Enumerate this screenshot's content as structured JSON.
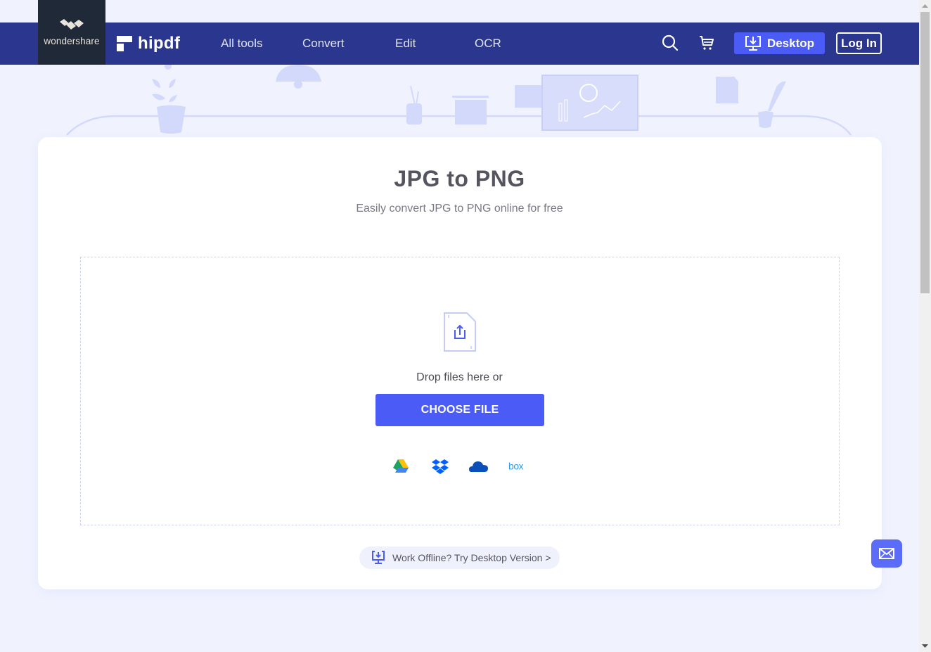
{
  "brand": {
    "parent_name": "wondershare",
    "product_name": "hipdf",
    "nav_color": "#2b378e",
    "accent": "#4b5cf6"
  },
  "nav": {
    "items": [
      {
        "label": "All tools"
      },
      {
        "label": "Convert"
      },
      {
        "label": "Edit"
      },
      {
        "label": "OCR"
      }
    ],
    "search_icon": "search-icon",
    "cart_icon": "cart-icon",
    "desktop_label": "Desktop",
    "login_label": "Log In"
  },
  "main": {
    "title": "JPG to PNG",
    "subtitle": "Easily convert JPG to PNG online for free",
    "drop_text": "Drop files here or",
    "choose_file_label": "CHOOSE FILE",
    "cloud_sources": [
      {
        "name": "Google Drive",
        "icon": "google-drive-icon"
      },
      {
        "name": "Dropbox",
        "icon": "dropbox-icon"
      },
      {
        "name": "OneDrive",
        "icon": "onedrive-icon"
      },
      {
        "name": "box",
        "icon": "box-icon"
      }
    ],
    "offline_text": "Work Offline? Try Desktop Version >"
  },
  "floating": {
    "mail_icon": "mail-icon"
  }
}
